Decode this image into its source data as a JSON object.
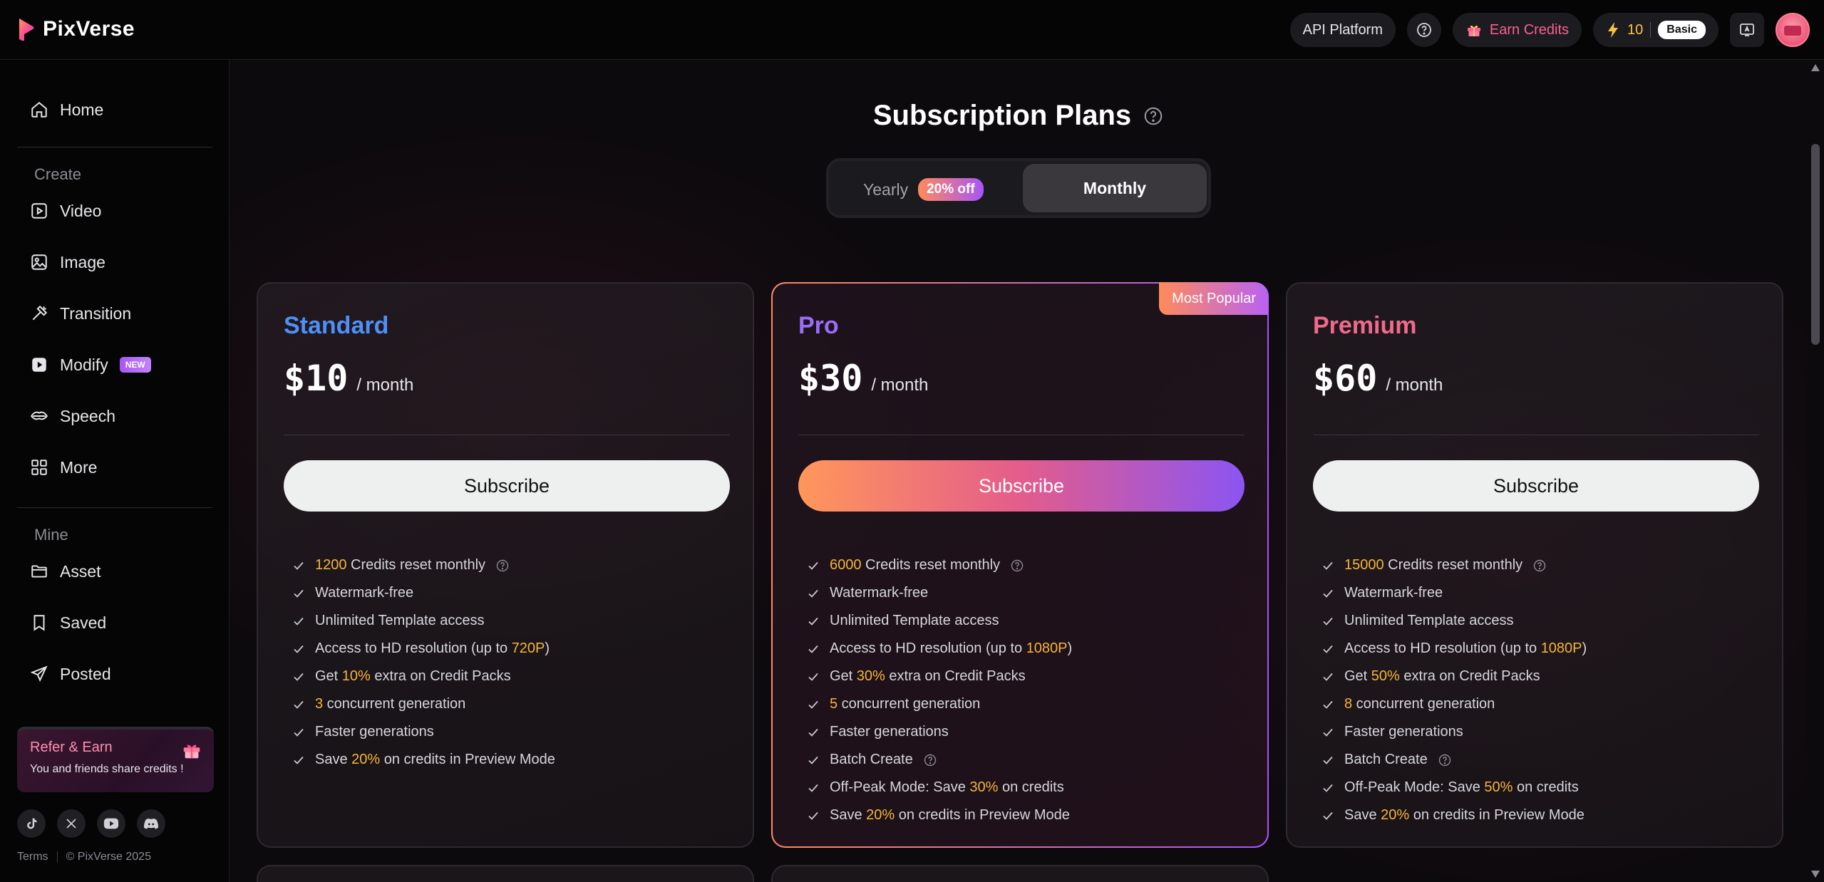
{
  "header": {
    "brand": "PixVerse",
    "api_platform": "API Platform",
    "earn_credits": "Earn Credits",
    "credits_count": "10",
    "plan_badge": "Basic",
    "accent_color": "#ff5f8f",
    "icons": [
      "pixverse-logo-icon",
      "help-icon",
      "gift-icon",
      "lightning-icon",
      "download-app-icon",
      "avatar"
    ]
  },
  "sidebar": {
    "home": "Home",
    "create_label": "Create",
    "create_items": [
      {
        "label": "Video",
        "icon": "video-icon"
      },
      {
        "label": "Image",
        "icon": "image-icon"
      },
      {
        "label": "Transition",
        "icon": "transition-icon"
      },
      {
        "label": "Modify",
        "icon": "modify-icon",
        "badge": "NEW"
      },
      {
        "label": "Speech",
        "icon": "speech-icon"
      },
      {
        "label": "More",
        "icon": "grid-icon"
      }
    ],
    "mine_label": "Mine",
    "mine_items": [
      {
        "label": "Asset",
        "icon": "folder-icon"
      },
      {
        "label": "Saved",
        "icon": "bookmark-icon"
      },
      {
        "label": "Posted",
        "icon": "send-icon"
      }
    ],
    "refer": {
      "title": "Refer & Earn",
      "subtitle": "You and friends share credits !"
    },
    "socials": [
      "tiktok-icon",
      "x-icon",
      "youtube-icon",
      "discord-icon"
    ],
    "footer": {
      "terms": "Terms",
      "copyright": "© PixVerse 2025"
    }
  },
  "main": {
    "title": "Subscription Plans",
    "toggle": {
      "yearly": "Yearly",
      "yearly_badge": "20% off",
      "monthly": "Monthly",
      "selected": "Monthly"
    },
    "plans": [
      {
        "name": "Standard",
        "name_color": "#4f8ff7",
        "price": "$10",
        "period": "/ month",
        "subscribe": "Subscribe",
        "features": [
          {
            "pre": "",
            "hl": "1200",
            "post": " Credits reset monthly",
            "help": true
          },
          {
            "pre": "Watermark-free",
            "hl": "",
            "post": ""
          },
          {
            "pre": "Unlimited Template access",
            "hl": "",
            "post": ""
          },
          {
            "pre": "Access to HD resolution (up to ",
            "hl": "720P",
            "post": ")"
          },
          {
            "pre": "Get ",
            "hl": "10%",
            "post": " extra on Credit Packs"
          },
          {
            "pre": "",
            "hl": "3",
            "post": " concurrent generation"
          },
          {
            "pre": "Faster generations",
            "hl": "",
            "post": ""
          },
          {
            "pre": "Save ",
            "hl": "20%",
            "post": " on credits in Preview Mode"
          }
        ]
      },
      {
        "name": "Pro",
        "name_color": "#9b6cf8",
        "price": "$30",
        "period": "/ month",
        "subscribe": "Subscribe",
        "ribbon": "Most Popular",
        "features": [
          {
            "pre": "",
            "hl": "6000",
            "post": " Credits reset monthly",
            "help": true
          },
          {
            "pre": "Watermark-free",
            "hl": "",
            "post": ""
          },
          {
            "pre": "Unlimited Template access",
            "hl": "",
            "post": ""
          },
          {
            "pre": "Access to HD resolution (up to ",
            "hl": "1080P",
            "post": ")"
          },
          {
            "pre": "Get ",
            "hl": "30%",
            "post": " extra on Credit Packs"
          },
          {
            "pre": "",
            "hl": "5",
            "post": " concurrent generation"
          },
          {
            "pre": "Faster generations",
            "hl": "",
            "post": ""
          },
          {
            "pre": "Batch Create",
            "hl": "",
            "post": "",
            "help": true
          },
          {
            "pre": "Off-Peak Mode: Save ",
            "hl": "30%",
            "post": " on credits"
          },
          {
            "pre": "Save ",
            "hl": "20%",
            "post": " on credits in Preview Mode"
          }
        ]
      },
      {
        "name": "Premium",
        "name_color": "#f06a8c",
        "price": "$60",
        "period": "/ month",
        "subscribe": "Subscribe",
        "features": [
          {
            "pre": "",
            "hl": "15000",
            "post": " Credits reset monthly",
            "help": true
          },
          {
            "pre": "Watermark-free",
            "hl": "",
            "post": ""
          },
          {
            "pre": "Unlimited Template access",
            "hl": "",
            "post": ""
          },
          {
            "pre": "Access to HD resolution (up to ",
            "hl": "1080P",
            "post": ")"
          },
          {
            "pre": "Get ",
            "hl": "50%",
            "post": " extra on Credit Packs"
          },
          {
            "pre": "",
            "hl": "8",
            "post": " concurrent generation"
          },
          {
            "pre": "Faster generations",
            "hl": "",
            "post": ""
          },
          {
            "pre": "Batch Create",
            "hl": "",
            "post": "",
            "help": true
          },
          {
            "pre": "Off-Peak Mode: Save ",
            "hl": "50%",
            "post": " on credits"
          },
          {
            "pre": "Save ",
            "hl": "20%",
            "post": " on credits in Preview Mode"
          }
        ]
      }
    ]
  }
}
